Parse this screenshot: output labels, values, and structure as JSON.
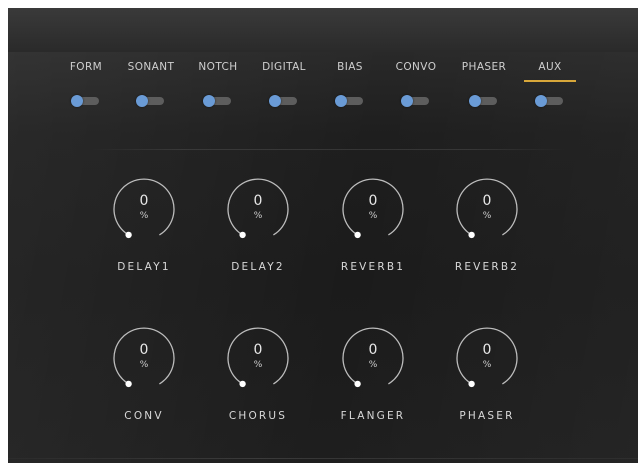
{
  "tabs": [
    {
      "label": "FORM",
      "active": false
    },
    {
      "label": "SONANT",
      "active": false
    },
    {
      "label": "NOTCH",
      "active": false
    },
    {
      "label": "DIGITAL",
      "active": false
    },
    {
      "label": "BIAS",
      "active": false
    },
    {
      "label": "CONVO",
      "active": false
    },
    {
      "label": "PHASER",
      "active": false
    },
    {
      "label": "AUX",
      "active": true
    }
  ],
  "knobs": [
    {
      "name": "DELAY1",
      "value": "0",
      "unit": "%"
    },
    {
      "name": "DELAY2",
      "value": "0",
      "unit": "%"
    },
    {
      "name": "REVERB1",
      "value": "0",
      "unit": "%"
    },
    {
      "name": "REVERB2",
      "value": "0",
      "unit": "%"
    },
    {
      "name": "CONV",
      "value": "0",
      "unit": "%"
    },
    {
      "name": "CHORUS",
      "value": "0",
      "unit": "%"
    },
    {
      "name": "FLANGER",
      "value": "0",
      "unit": "%"
    },
    {
      "name": "PHASER",
      "value": "0",
      "unit": "%"
    }
  ],
  "colors": {
    "accent": "#d8a73a",
    "toggle_knob": "#6a9bd6",
    "knob_ring": "#bdbdbd",
    "panel_bg": "#1e1e1e"
  }
}
